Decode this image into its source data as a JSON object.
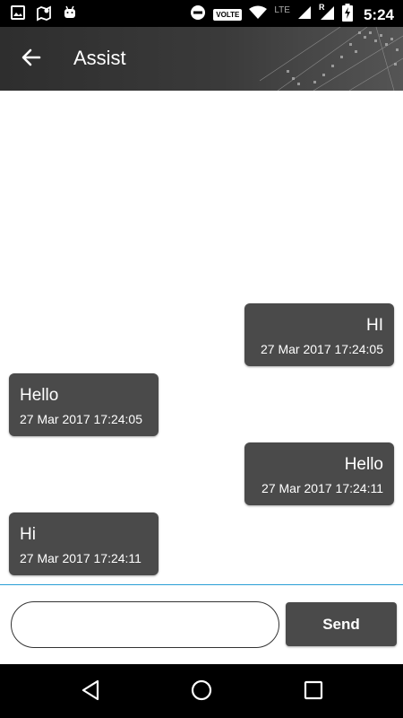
{
  "status_bar": {
    "time": "5:24",
    "volte_label": "VOLTE",
    "network_label": "LTE",
    "roaming_label": "R",
    "icons": [
      "image-icon",
      "map-icon",
      "android-icon",
      "do-not-disturb-icon",
      "wifi-icon",
      "signal-icon",
      "battery-charging-icon"
    ]
  },
  "toolbar": {
    "title": "Assist",
    "back_icon": "arrow-left-icon"
  },
  "messages": [
    {
      "direction": "out",
      "text": "HI",
      "timestamp": "27 Mar 2017 17:24:05"
    },
    {
      "direction": "in",
      "text": "Hello",
      "timestamp": "27 Mar 2017 17:24:05"
    },
    {
      "direction": "out",
      "text": "Hello",
      "timestamp": "27 Mar 2017 17:24:11"
    },
    {
      "direction": "in",
      "text": "Hi",
      "timestamp": "27 Mar 2017 17:24:11"
    }
  ],
  "composer": {
    "input_value": "",
    "send_label": "Send"
  },
  "nav_bar": {
    "icons": [
      "back-triangle-icon",
      "home-circle-icon",
      "recents-square-icon"
    ]
  },
  "colors": {
    "bubble": "#4a4a4a",
    "divider": "#2a9fd6",
    "toolbar": "#2e2e2e"
  }
}
